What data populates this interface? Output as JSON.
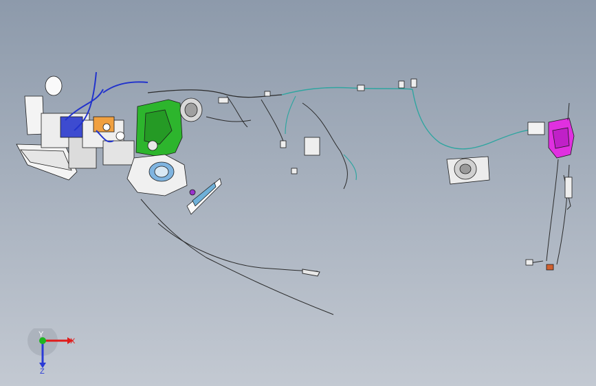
{
  "viewport": {
    "background_top": "#8d9aab",
    "background_bottom": "#c3c9d2"
  },
  "model": {
    "colors": {
      "wire": "#2a2a2a",
      "wire_teal": "#2fa5a0",
      "wire_blue": "#2233cc",
      "green_part": "#2db52d",
      "magenta_part": "#e030e0",
      "part_outline": "#1b1b1b",
      "part_fill": "#f2f2f2"
    }
  },
  "triad": {
    "x_label": "X",
    "y_label": "Y",
    "z_label": "Z",
    "colors": {
      "x": "#e01b1b",
      "y": "#1fb51f",
      "z": "#2a3ad6"
    }
  }
}
